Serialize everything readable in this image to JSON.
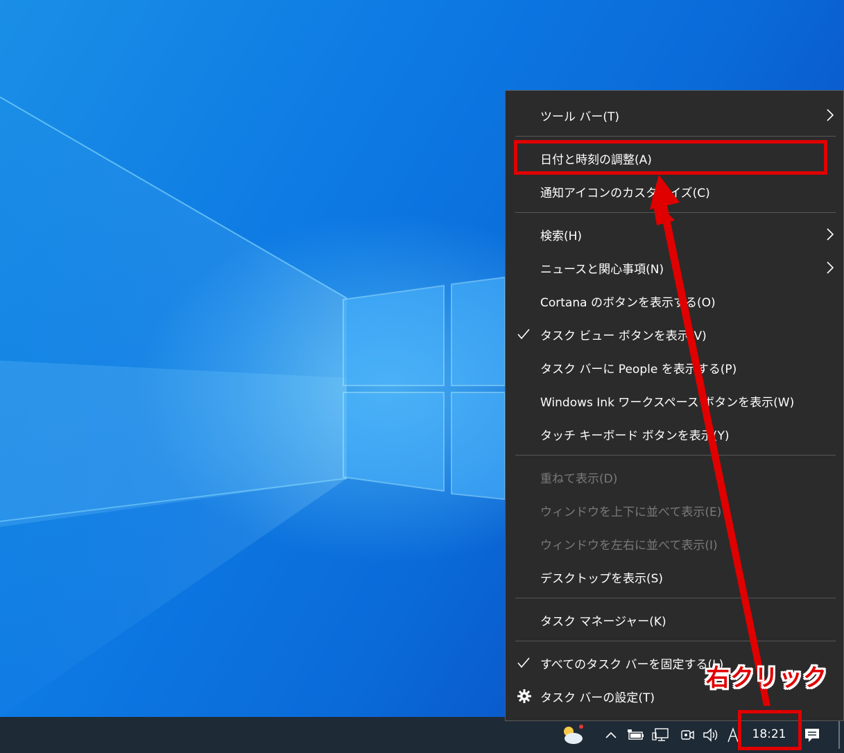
{
  "context_menu": {
    "items": [
      {
        "label": "ツール バー(T)"
      },
      {
        "label": "日付と時刻の調整(A)"
      },
      {
        "label": "通知アイコンのカスタマイズ(C)"
      },
      {
        "label": "検索(H)"
      },
      {
        "label": "ニュースと関心事項(N)"
      },
      {
        "label": "Cortana のボタンを表示する(O)"
      },
      {
        "label": "タスク ビュー ボタンを表示(V)",
        "checked": true
      },
      {
        "label": "タスク バーに People を表示する(P)"
      },
      {
        "label": "Windows Ink ワークスペース ボタンを表示(W)"
      },
      {
        "label": "タッチ キーボード ボタンを表示(Y)"
      },
      {
        "label": "重ねて表示(D)",
        "disabled": true
      },
      {
        "label": "ウィンドウを上下に並べて表示(E)",
        "disabled": true
      },
      {
        "label": "ウィンドウを左右に並べて表示(I)",
        "disabled": true
      },
      {
        "label": "デスクトップを表示(S)"
      },
      {
        "label": "タスク マネージャー(K)"
      },
      {
        "label": "すべてのタスク バーを固定する(L)",
        "checked": true
      },
      {
        "label": "タスク バーの設定(T)",
        "icon": "gear-icon"
      }
    ]
  },
  "taskbar": {
    "clock": "18:21",
    "tray_icons": [
      "weather-icon",
      "chevron-up-icon",
      "battery-icon",
      "network-icon",
      "meet-now-icon",
      "volume-icon",
      "ime-icon",
      "action-center-icon"
    ]
  },
  "annotation": {
    "label": "右クリック",
    "color": "#e00000"
  }
}
